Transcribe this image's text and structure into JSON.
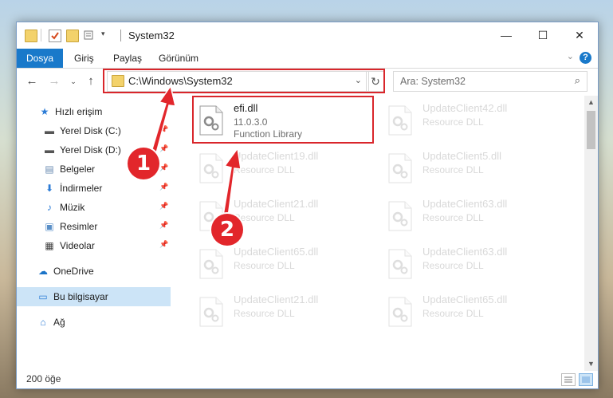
{
  "window": {
    "title": "System32",
    "controls": {
      "minimize": "—",
      "maximize": "☐",
      "close": "✕"
    }
  },
  "ribbon": {
    "tabs": [
      "Dosya",
      "Giriş",
      "Paylaş",
      "Görünüm"
    ],
    "help": "?"
  },
  "nav": {
    "address": "C:\\Windows\\System32",
    "search_placeholder": "Ara: System32"
  },
  "sidebar": {
    "items": [
      {
        "label": "Hızlı erişim",
        "icon": "star-icon",
        "pinned": false
      },
      {
        "label": "Yerel Disk (C:)",
        "icon": "drive-icon",
        "pinned": true
      },
      {
        "label": "Yerel Disk (D:)",
        "icon": "drive-icon",
        "pinned": true
      },
      {
        "label": "Belgeler",
        "icon": "documents-icon",
        "pinned": true
      },
      {
        "label": "İndirmeler",
        "icon": "download-icon",
        "pinned": true
      },
      {
        "label": "Müzik",
        "icon": "music-icon",
        "pinned": true
      },
      {
        "label": "Resimler",
        "icon": "pictures-icon",
        "pinned": true
      },
      {
        "label": "Videolar",
        "icon": "video-icon",
        "pinned": true
      },
      {
        "label": "OneDrive",
        "icon": "cloud-icon",
        "pinned": false
      },
      {
        "label": "Bu bilgisayar",
        "icon": "computer-icon",
        "pinned": false,
        "selected": true
      },
      {
        "label": "Ağ",
        "icon": "network-icon",
        "pinned": false
      }
    ]
  },
  "files": [
    {
      "name": "efi.dll",
      "version": "11.0.3.0",
      "description": "Function Library",
      "highlighted": true
    },
    {
      "name": "UpdateClient42.dll",
      "description": "Resource DLL"
    },
    {
      "name": "UpdateClient19.dll",
      "description": "Resource DLL"
    },
    {
      "name": "UpdateClient5.dll",
      "description": "Resource DLL"
    },
    {
      "name": "UpdateClient21.dll",
      "description": "Resource DLL"
    },
    {
      "name": "UpdateClient63.dll",
      "description": "Resource DLL"
    },
    {
      "name": "UpdateClient65.dll",
      "description": "Resource DLL"
    },
    {
      "name": "UpdateClient63.dll",
      "description": "Resource DLL"
    },
    {
      "name": "UpdateClient21.dll",
      "description": "Resource DLL"
    },
    {
      "name": "UpdateClient65.dll",
      "description": "Resource DLL"
    }
  ],
  "status": {
    "count": "200 öğe"
  },
  "annotations": {
    "step1": "1",
    "step2": "2",
    "color": "#e2262b"
  }
}
